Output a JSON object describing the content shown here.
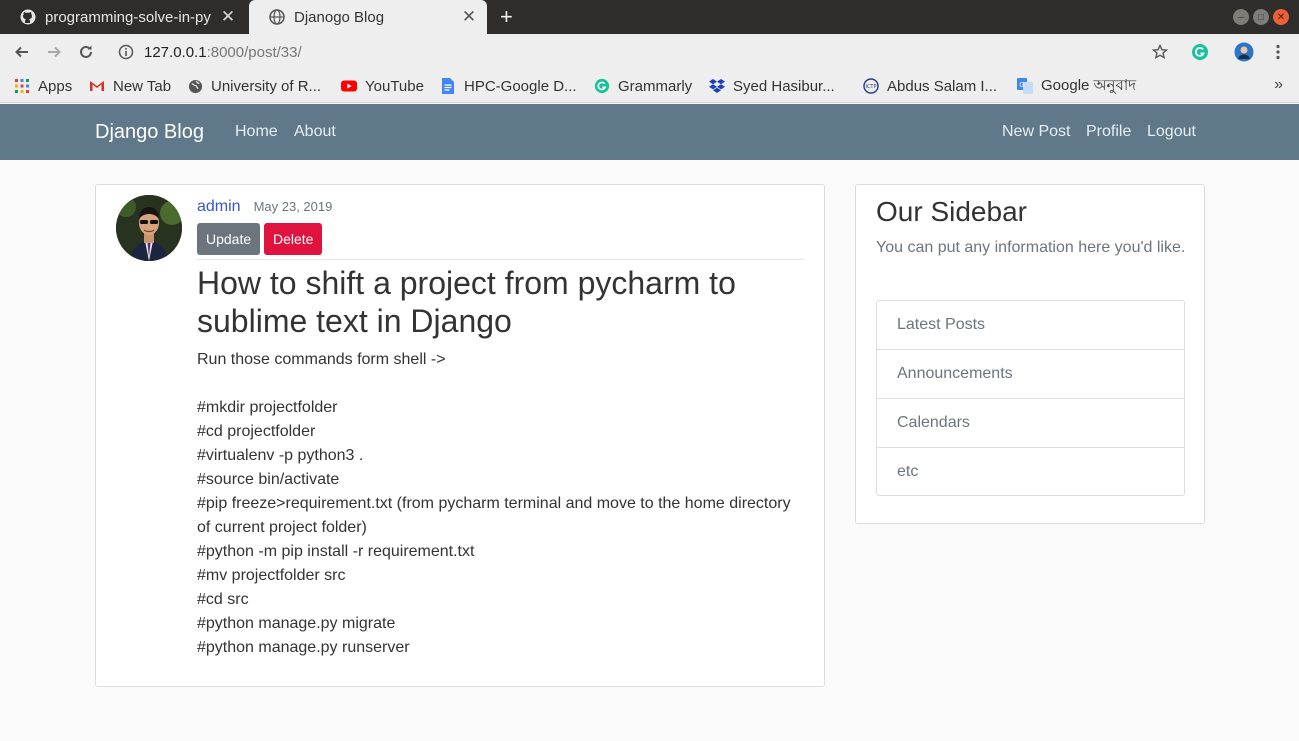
{
  "browser": {
    "tabs": [
      {
        "title": "programming-solve-in-py",
        "active": false
      },
      {
        "title": "Djanogo Blog",
        "active": true
      }
    ],
    "new_tab_symbol": "+",
    "address": {
      "host": "127.0.0.1",
      "path": ":8000/post/33/"
    },
    "bookmarks": [
      {
        "label": "Apps",
        "icon": "apps-grid-icon"
      },
      {
        "label": "New Tab",
        "icon": "gmail-icon"
      },
      {
        "label": "University of R...",
        "icon": "globe-icon"
      },
      {
        "label": "YouTube",
        "icon": "youtube-icon"
      },
      {
        "label": "HPC-Google D...",
        "icon": "docs-icon"
      },
      {
        "label": "Grammarly",
        "icon": "grammarly-icon"
      },
      {
        "label": "Syed Hasibur...",
        "icon": "dropbox-icon"
      },
      {
        "label": "Abdus Salam I...",
        "icon": "ictp-icon"
      },
      {
        "label": "Google অনুবাদ",
        "icon": "translate-icon"
      }
    ],
    "bookmarks_more": "»"
  },
  "site": {
    "brand": "Django Blog",
    "nav_left": [
      "Home",
      "About"
    ],
    "nav_right": [
      "New Post",
      "Profile",
      "Logout"
    ]
  },
  "post": {
    "author": "admin",
    "date": "May 23, 2019",
    "update_label": "Update",
    "delete_label": "Delete",
    "title": "How to shift a project from pycharm to sublime text in Django",
    "body": [
      "Run those commands form shell ->",
      "",
      "#mkdir projectfolder",
      "#cd projectfolder",
      "#virtualenv -p python3 .",
      "#source bin/activate",
      "#pip freeze>requirement.txt (from pycharm terminal and move to the home directory of current project folder)",
      "#python -m pip install -r requirement.txt",
      "#mv projectfolder src",
      "#cd src",
      "#python manage.py migrate",
      "#python manage.py runserver"
    ]
  },
  "sidebar": {
    "title": "Our Sidebar",
    "description": "You can put any information here you'd like.",
    "items": [
      "Latest Posts",
      "Announcements",
      "Calendars",
      "etc"
    ]
  },
  "colors": {
    "navbar": "#5f788a",
    "author_link": "#3a57c4",
    "delete_button": "#e0133f",
    "update_button": "#6c757d"
  }
}
